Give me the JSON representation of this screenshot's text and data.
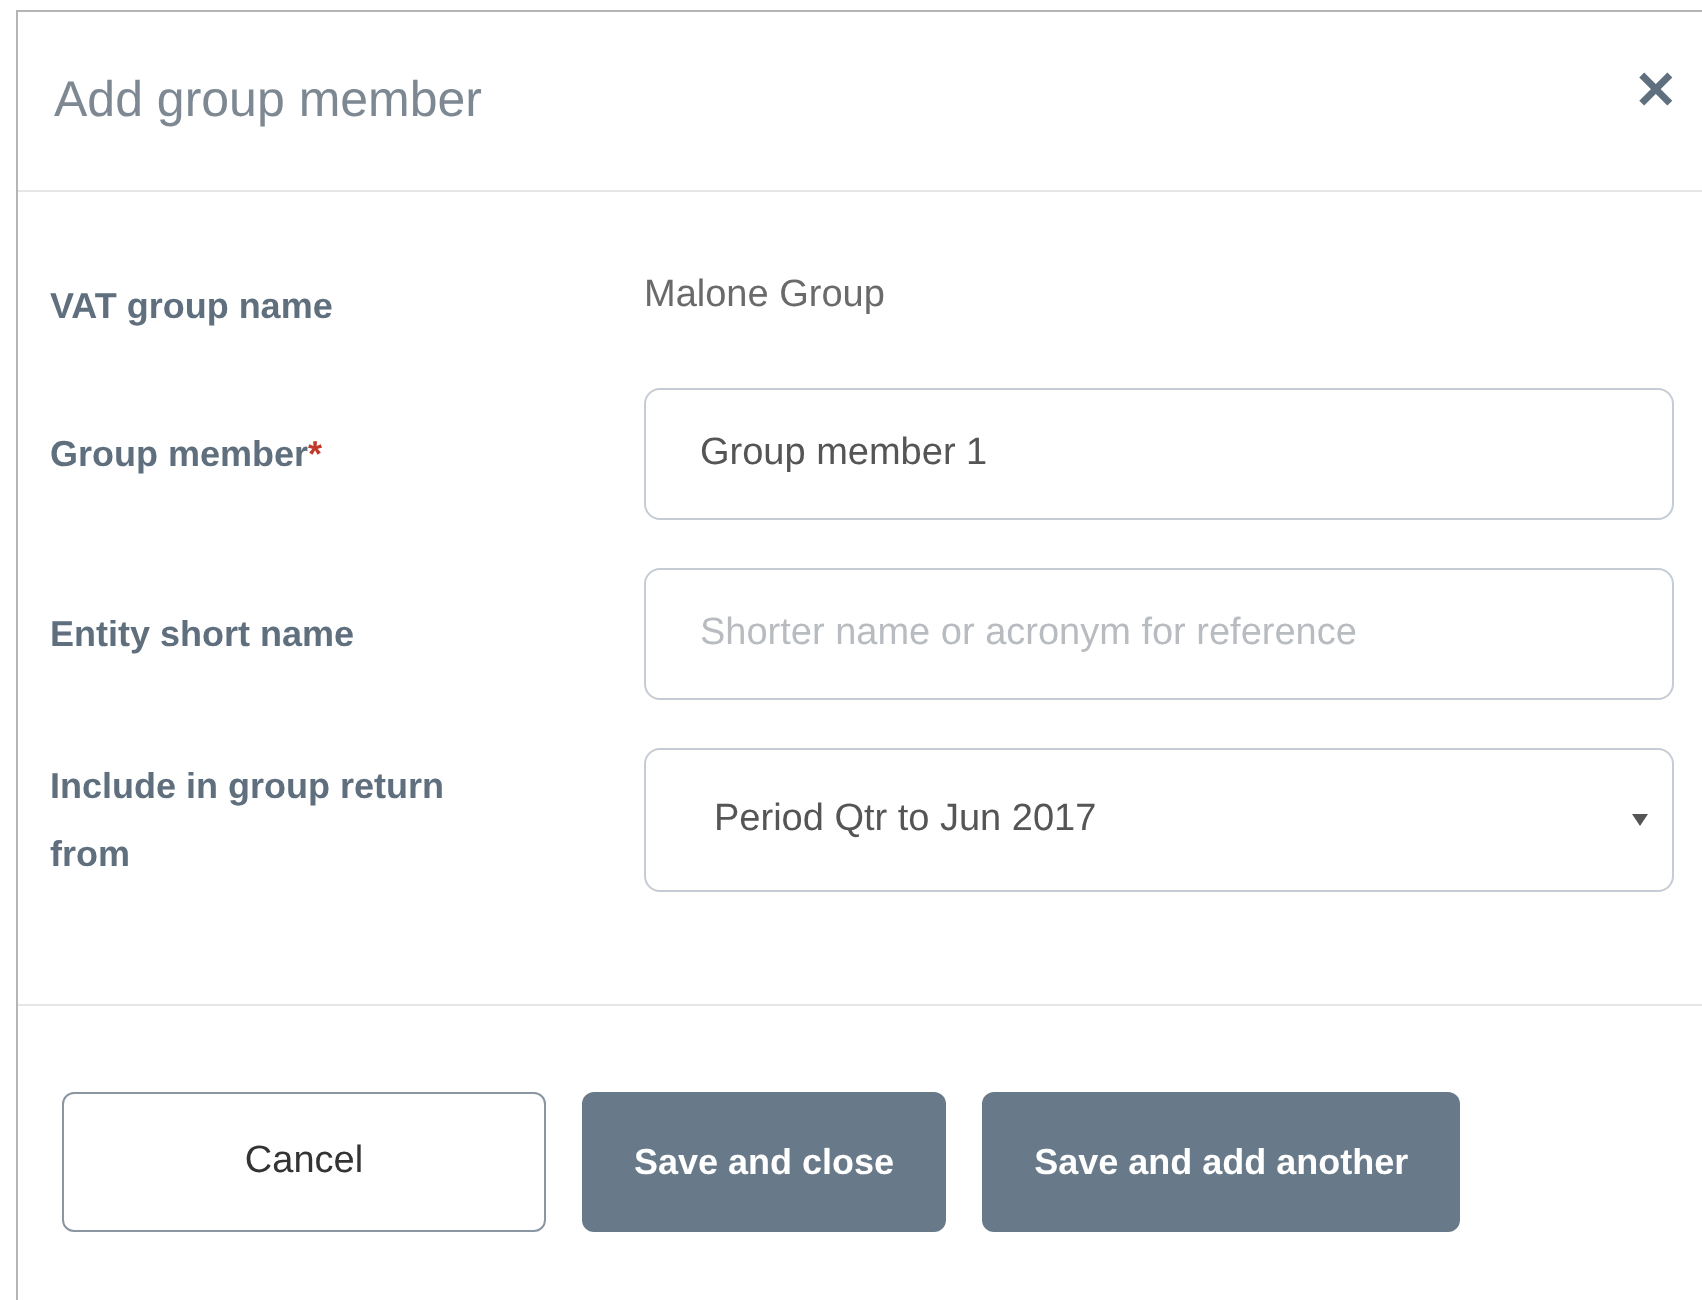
{
  "dialog": {
    "title": "Add group member",
    "close": "✕"
  },
  "fields": [
    {
      "kind": "static",
      "label": "VAT group name",
      "value": "Malone Group"
    },
    {
      "kind": "input",
      "label": "Group member",
      "required_mark": "*",
      "value": "Group member 1"
    },
    {
      "kind": "input",
      "label": "Entity short name",
      "placeholder": "Shorter name or acronym for reference"
    },
    {
      "kind": "select",
      "label": "Include in group return from",
      "value": "Period Qtr to Jun 2017"
    }
  ],
  "buttons": [
    {
      "kind": "secondary",
      "label": "Cancel"
    },
    {
      "kind": "primary",
      "label": "Save and close"
    },
    {
      "kind": "primary",
      "label": "Save and add another"
    }
  ]
}
